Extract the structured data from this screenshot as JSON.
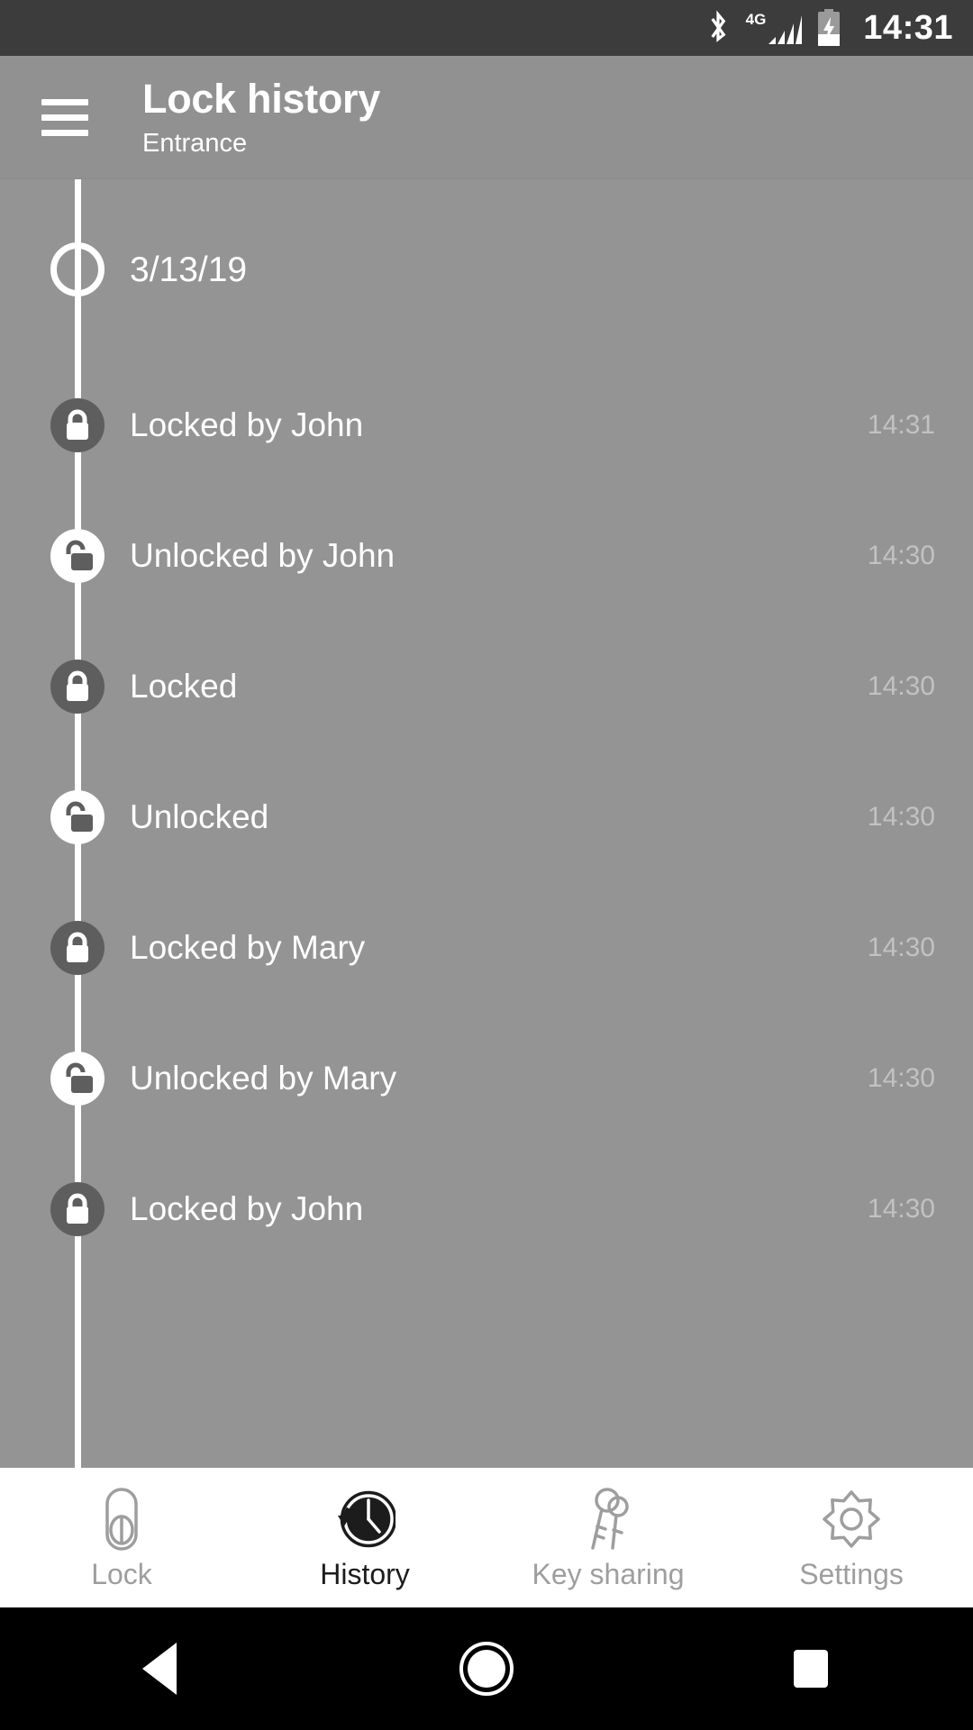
{
  "status_bar": {
    "bluetooth_icon": "bluetooth-icon",
    "network_label": "4G",
    "signal_icon": "signal-bars-icon",
    "battery_icon": "battery-charging-icon",
    "time": "14:31"
  },
  "app_bar": {
    "menu_icon": "hamburger-menu-icon",
    "title": "Lock history",
    "subtitle": "Entrance"
  },
  "timeline": {
    "date_marker": {
      "label": "3/13/19",
      "icon": "circle-outline-icon"
    },
    "events": [
      {
        "label": "Locked by John",
        "time": "14:31",
        "state": "locked"
      },
      {
        "label": "Unlocked by John",
        "time": "14:30",
        "state": "unlocked"
      },
      {
        "label": "Locked",
        "time": "14:30",
        "state": "locked"
      },
      {
        "label": "Unlocked",
        "time": "14:30",
        "state": "unlocked"
      },
      {
        "label": "Locked by Mary",
        "time": "14:30",
        "state": "locked"
      },
      {
        "label": "Unlocked by Mary",
        "time": "14:30",
        "state": "unlocked"
      },
      {
        "label": "Locked by John",
        "time": "14:30",
        "state": "locked"
      }
    ]
  },
  "bottom_nav": {
    "items": [
      {
        "label": "Lock",
        "icon": "lock-cylinder-icon",
        "active": false
      },
      {
        "label": "History",
        "icon": "clock-history-icon",
        "active": true
      },
      {
        "label": "Key sharing",
        "icon": "keys-icon",
        "active": false
      },
      {
        "label": "Settings",
        "icon": "gear-icon",
        "active": false
      }
    ]
  },
  "android_nav": {
    "back": "back-triangle-icon",
    "home": "home-circle-icon",
    "recents": "recents-square-icon"
  },
  "colors": {
    "status_bar_bg": "#3c3c3c",
    "app_bar_bg": "#919191",
    "page_bg": "#949494",
    "locked_marker": "#5e5e5e",
    "unlocked_marker": "#ffffff",
    "time_text": "#c2c2c2",
    "nav_inactive": "#9e9e9e",
    "nav_active": "#1c1c1c"
  }
}
